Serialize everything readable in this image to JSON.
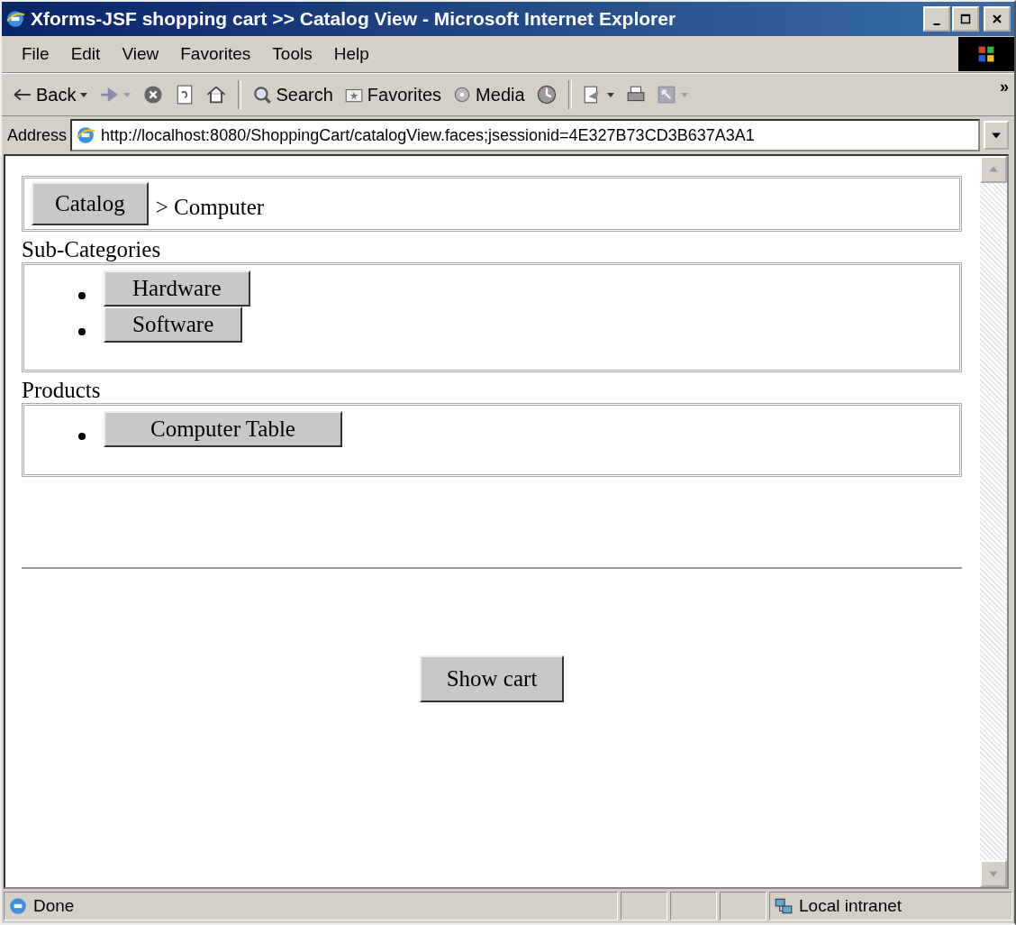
{
  "window": {
    "title": "Xforms-JSF shopping cart >> Catalog View - Microsoft Internet Explorer"
  },
  "menu": [
    "File",
    "Edit",
    "View",
    "Favorites",
    "Tools",
    "Help"
  ],
  "toolbar": [
    {
      "kind": "back",
      "label": "Back"
    },
    {
      "kind": "forward"
    },
    {
      "kind": "stop"
    },
    {
      "kind": "refresh"
    },
    {
      "kind": "home"
    },
    {
      "kind": "separator"
    },
    {
      "kind": "search",
      "label": "Search"
    },
    {
      "kind": "favorites",
      "label": "Favorites"
    },
    {
      "kind": "media",
      "label": "Media"
    },
    {
      "kind": "history"
    },
    {
      "kind": "separator"
    },
    {
      "kind": "mail"
    },
    {
      "kind": "print"
    },
    {
      "kind": "edit"
    },
    {
      "kind": "more",
      "label": "»"
    }
  ],
  "address": {
    "label": "Address",
    "value": "http://localhost:8080/ShoppingCart/catalogView.faces;jsessionid=4E327B73CD3B637A3A1"
  },
  "breadcrumb": {
    "button": "Catalog",
    "trail": "> Computer"
  },
  "sections": [
    {
      "title": "Sub-Categories",
      "items": [
        "Hardware",
        "Software"
      ]
    },
    {
      "title": "Products",
      "items": [
        "Computer Table"
      ]
    }
  ],
  "show_cart": "Show cart",
  "status_bar": {
    "text": "Done",
    "zone": "Local intranet"
  }
}
